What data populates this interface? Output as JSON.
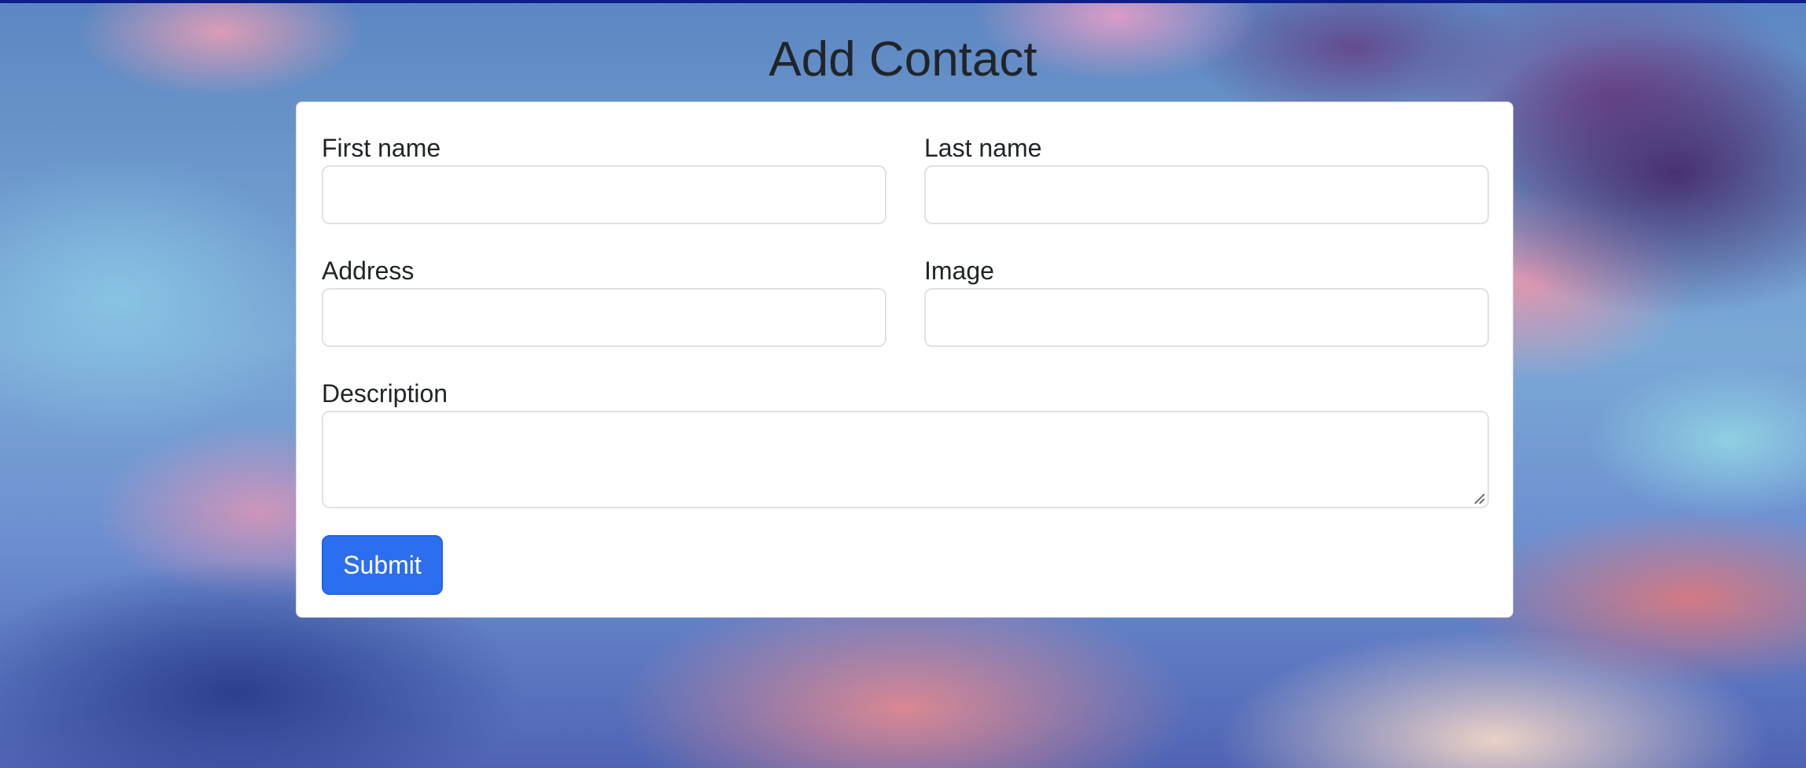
{
  "page": {
    "title": "Add Contact"
  },
  "form": {
    "first_name": {
      "label": "First name",
      "value": "",
      "placeholder": ""
    },
    "last_name": {
      "label": "Last name",
      "value": "",
      "placeholder": ""
    },
    "address": {
      "label": "Address",
      "value": "",
      "placeholder": ""
    },
    "image": {
      "label": "Image",
      "value": "",
      "placeholder": ""
    },
    "description": {
      "label": "Description",
      "value": "",
      "placeholder": ""
    },
    "submit_label": "Submit"
  },
  "colors": {
    "primary_button": "#2b6ff0",
    "top_bar": "#0d1e8a",
    "text": "#212529"
  },
  "background": {
    "image": "sky-clouds-background"
  }
}
